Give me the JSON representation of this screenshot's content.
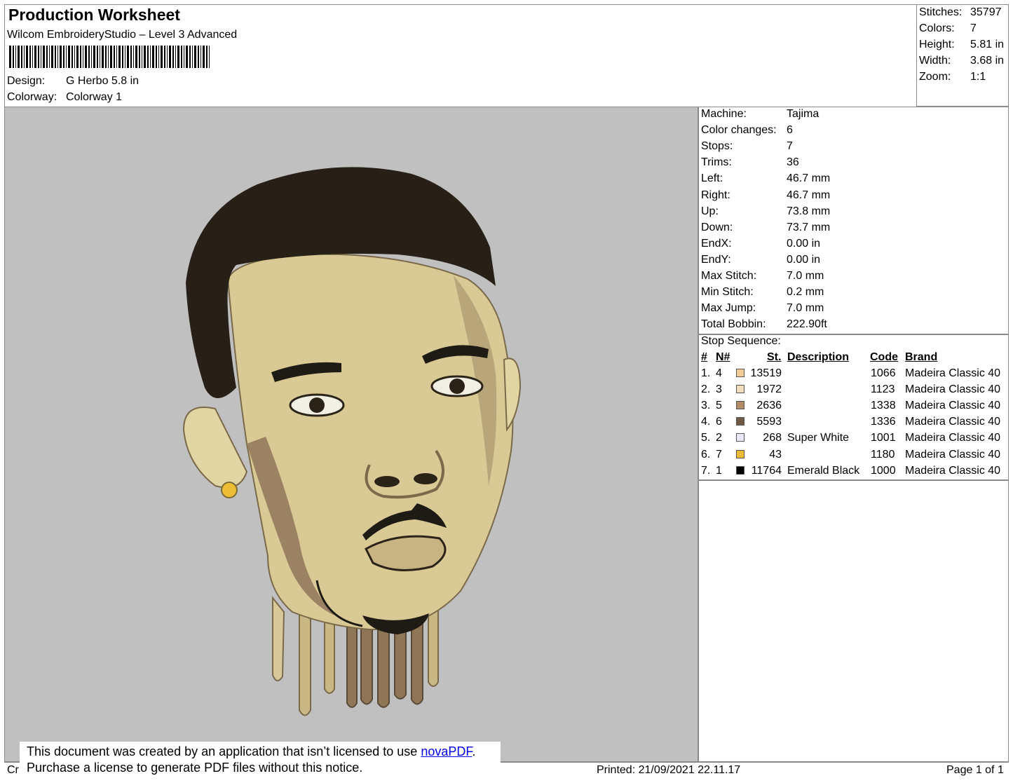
{
  "header": {
    "title": "Production Worksheet",
    "software": "Wilcom EmbroideryStudio – Level 3 Advanced",
    "design_label": "Design:",
    "design_value": "G Herbo 5.8 in",
    "colorway_label": "Colorway:",
    "colorway_value": "Colorway 1"
  },
  "summary": [
    {
      "label": "Stitches:",
      "value": "35797"
    },
    {
      "label": "Colors:",
      "value": "7"
    },
    {
      "label": "Height:",
      "value": "5.81 in"
    },
    {
      "label": "Width:",
      "value": "3.68 in"
    },
    {
      "label": "Zoom:",
      "value": "1:1"
    }
  ],
  "machine_info": [
    {
      "label": "Machine:",
      "value": "Tajima"
    },
    {
      "label": "Color changes:",
      "value": "6"
    },
    {
      "label": "Stops:",
      "value": "7"
    },
    {
      "label": "Trims:",
      "value": "36"
    },
    {
      "label": "Left:",
      "value": "46.7 mm"
    },
    {
      "label": "Right:",
      "value": "46.7 mm"
    },
    {
      "label": "Up:",
      "value": "73.8 mm"
    },
    {
      "label": "Down:",
      "value": "73.7 mm"
    },
    {
      "label": "EndX:",
      "value": "0.00 in"
    },
    {
      "label": "EndY:",
      "value": "0.00 in"
    },
    {
      "label": "Max Stitch:",
      "value": "7.0 mm"
    },
    {
      "label": "Min Stitch:",
      "value": "0.2 mm"
    },
    {
      "label": "Max Jump:",
      "value": "7.0 mm"
    },
    {
      "label": "Total Bobbin:",
      "value": "222.90ft"
    }
  ],
  "stop_sequence": {
    "title": "Stop Sequence:",
    "headers": {
      "idx": "#",
      "needle": "N#",
      "stitches": "St.",
      "description": "Description",
      "code": "Code",
      "brand": "Brand"
    },
    "rows": [
      {
        "idx": "1.",
        "needle": "4",
        "color": "#f2cd98",
        "stitches": "13519",
        "description": "",
        "code": "1066",
        "brand": "Madeira Classic 40"
      },
      {
        "idx": "2.",
        "needle": "3",
        "color": "#f3dfbd",
        "stitches": "1972",
        "description": "",
        "code": "1123",
        "brand": "Madeira Classic 40"
      },
      {
        "idx": "3.",
        "needle": "5",
        "color": "#b08d66",
        "stitches": "2636",
        "description": "",
        "code": "1338",
        "brand": "Madeira Classic 40"
      },
      {
        "idx": "4.",
        "needle": "6",
        "color": "#6e5848",
        "stitches": "5593",
        "description": "",
        "code": "1336",
        "brand": "Madeira Classic 40"
      },
      {
        "idx": "5.",
        "needle": "2",
        "color": "#e9e9fb",
        "stitches": "268",
        "description": "Super White",
        "code": "1001",
        "brand": "Madeira Classic 40"
      },
      {
        "idx": "6.",
        "needle": "7",
        "color": "#ecbd35",
        "stitches": "43",
        "description": "",
        "code": "1180",
        "brand": "Madeira Classic 40"
      },
      {
        "idx": "7.",
        "needle": "1",
        "color": "#000000",
        "stitches": "11764",
        "description": "Emerald Black",
        "code": "1000",
        "brand": "Madeira Classic 40"
      }
    ]
  },
  "footer": {
    "created_prefix": "Cr",
    "printed": "Printed: 21/09/2021 22.11.17",
    "page": "Page 1 of 1"
  },
  "notice": {
    "line1_text": "This document was created by an application that isn’t licensed to use ",
    "link": "novaPDF",
    "line1_end": ".",
    "line2": "Purchase a license to generate PDF files without this notice."
  },
  "colors": {
    "canvas_bg": "#c0c0c0",
    "border": "#8a8a8a",
    "link": "#0000ee"
  }
}
